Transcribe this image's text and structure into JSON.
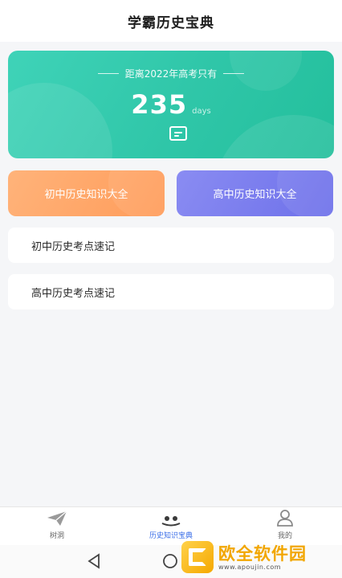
{
  "app": {
    "title": "学霸历史宝典"
  },
  "countdown": {
    "caption": "距离2022年高考只有",
    "days": "235",
    "unit": "days"
  },
  "categories": [
    {
      "label": "初中历史知识大全",
      "color": "#ff9c5a"
    },
    {
      "label": "高中历史知识大全",
      "color": "#6d70ea"
    }
  ],
  "quick_notes": [
    {
      "label": "初中历史考点速记"
    },
    {
      "label": "高中历史考点速记"
    }
  ],
  "tabbar": {
    "tabs": [
      {
        "label": "树洞",
        "icon": "paper-plane-icon",
        "active": false
      },
      {
        "label": "历史知识宝典",
        "icon": "book-icon",
        "active": true
      },
      {
        "label": "我的",
        "icon": "user-icon",
        "active": false
      }
    ]
  },
  "system_nav": {
    "back_icon": "back-triangle-icon",
    "home_icon": "home-circle-icon"
  },
  "watermark": {
    "name": "欧全软件园",
    "url": "www.apoujin.com"
  },
  "colors": {
    "hero": "#2fc6a8",
    "accent_active_tab": "#3a6ee8",
    "background": "#f5f6f8"
  }
}
